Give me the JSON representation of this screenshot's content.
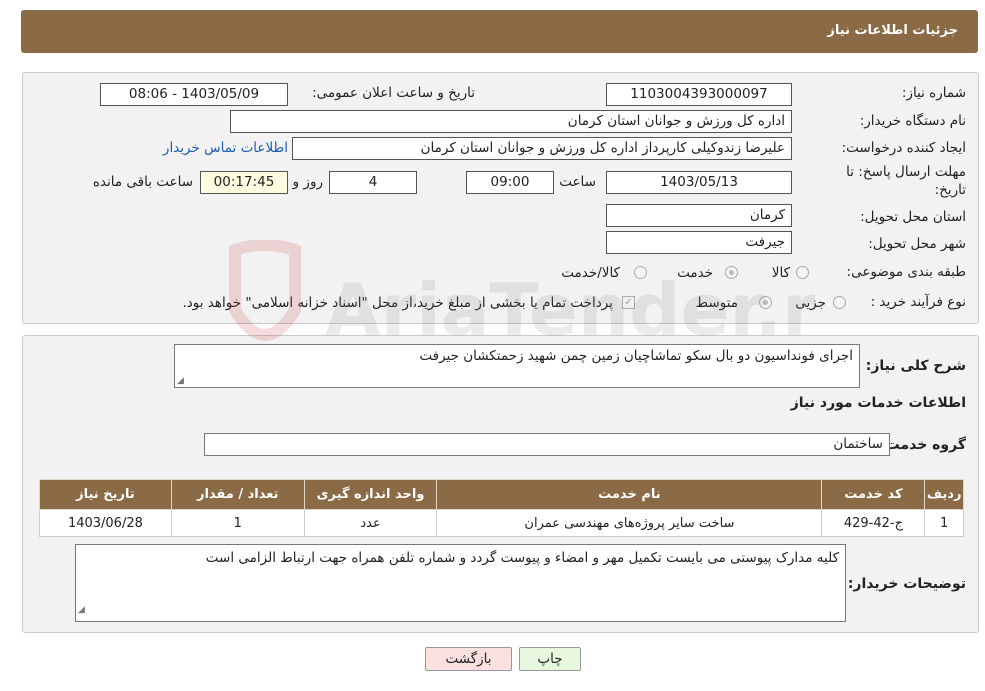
{
  "header": {
    "title": "جزئیات اطلاعات نیاز"
  },
  "form": {
    "need_number_label": "شماره نیاز:",
    "need_number": "1103004393000097",
    "announce_label": "تاریخ و ساعت اعلان عمومی:",
    "announce_value": "1403/05/09 - 08:06",
    "buyer_label": "نام دستگاه خریدار:",
    "buyer_value": "اداره کل ورزش و جوانان استان کرمان",
    "creator_label": "ایجاد کننده درخواست:",
    "creator_value": "علیرضا  زندوکیلی  کارپرداز اداره کل ورزش و جوانان استان کرمان",
    "contact_link": "اطلاعات تماس خریدار",
    "deadline_label_1": "مهلت ارسال پاسخ: تا",
    "deadline_label_2": "تاریخ:",
    "deadline_date": "1403/05/13",
    "time_label": "ساعت",
    "deadline_time": "09:00",
    "days_value": "4",
    "days_label": "روز و",
    "remaining_time": "00:17:45",
    "remaining_label": "ساعت باقی مانده",
    "province_label": "استان محل تحویل:",
    "province_value": "کرمان",
    "city_label": "شهر محل تحویل:",
    "city_value": "جیرفت",
    "category_label": "طبقه بندی موضوعی:",
    "category_options": [
      {
        "label": "کالا",
        "selected": false
      },
      {
        "label": "خدمت",
        "selected": true
      },
      {
        "label": "کالا/خدمت",
        "selected": false
      }
    ],
    "process_label": "نوع فرآیند خرید :",
    "process_options": [
      {
        "label": "جزیی",
        "selected": false
      },
      {
        "label": "متوسط",
        "selected": true
      }
    ],
    "payment_note": "پرداخت تمام یا بخشی از مبلغ خرید،از محل \"اسناد خزانه اسلامی\" خواهد بود."
  },
  "details": {
    "description_label": "شرح کلی نیاز:",
    "description_value": "اجرای فونداسیون دو بال سکو تماشاچیان زمین چمن شهید زحمتکشان جیرفت",
    "services_heading": "اطلاعات خدمات مورد نیاز",
    "service_group_label": "گروه خدمت:",
    "service_group_value": "ساختمان",
    "table": {
      "headers": [
        "ردیف",
        "کد خدمت",
        "نام خدمت",
        "واحد اندازه گیری",
        "تعداد / مقدار",
        "تاریخ نیاز"
      ],
      "rows": [
        [
          "1",
          "ج-42-429",
          "ساخت سایر پروژه‌های مهندسی عمران",
          "عدد",
          "1",
          "1403/06/28"
        ]
      ]
    },
    "buyer_notes_label": "توضیحات خریدار:",
    "buyer_notes_value": "کلیه مدارک پیوستی می بایست تکمیل مهر و امضاء و پیوست گردد و شماره تلفن همراه جهت ارتباط الزامی است"
  },
  "buttons": {
    "print": "چاپ",
    "back": "بازگشت"
  },
  "watermark": {
    "text": "AriaTender.net"
  }
}
